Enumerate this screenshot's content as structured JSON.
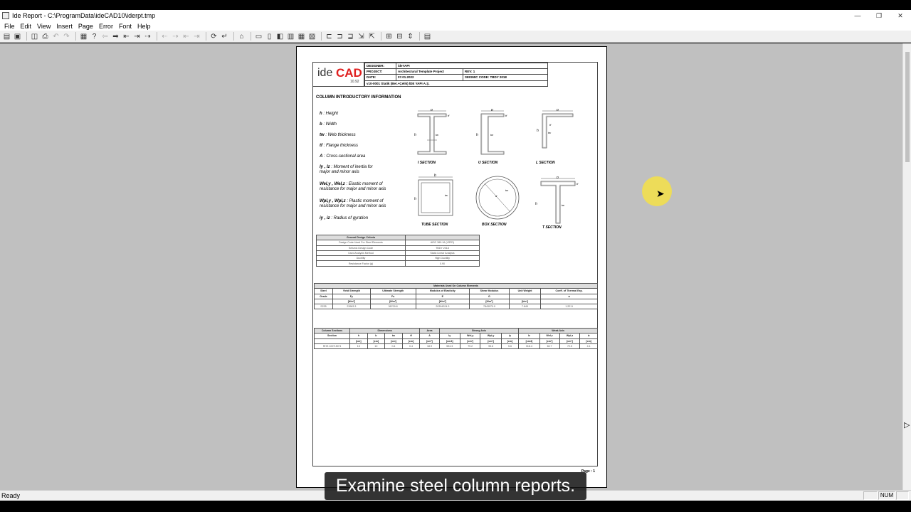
{
  "window": {
    "title": "Ide Report - C:\\ProgramData\\ideCAD10\\iderpt.tmp",
    "minimize": "—",
    "maximize": "❐",
    "close": "✕"
  },
  "menu": [
    "File",
    "Edit",
    "View",
    "Insert",
    "Page",
    "Error",
    "Font",
    "Help"
  ],
  "status": {
    "text": "Ready",
    "num": "NUM"
  },
  "report": {
    "logo": {
      "ide": "ide",
      "cad": "CAD",
      "version": "10.92"
    },
    "header": {
      "designer_label": "DESIGNER:",
      "designer": "ideYAPI",
      "project_label": "PROJECT:",
      "project": "Architectural Template Project",
      "rev": "REV: 1",
      "date_label": "DATE:",
      "date": "07.01.2022",
      "seismic": "SEISMIC CODE: TBDY 2018",
      "footer": "v10-0001 Statik (Bet.+Çelik) İDE YAPI A.Ş."
    },
    "section_title": "COLUMN INTRODUCTORY INFORMATION",
    "legend": [
      {
        "sym": "h",
        "text": ": Height"
      },
      {
        "sym": "b",
        "text": ": Width"
      },
      {
        "sym": "tw",
        "text": ": Web thickness"
      },
      {
        "sym": "tf",
        "text": ": Flange thickness"
      },
      {
        "sym": "A",
        "text": ": Cross-sectional area"
      },
      {
        "sym": "Iy , Iz",
        "text": ": Moment of inertia for",
        "text2": "major and minor axis"
      },
      {
        "sym": "Wel,y , Wel,z",
        "text": ": Elastic moment of",
        "text2": "resistance for major and minor axis"
      },
      {
        "sym": "Wpl,y , Wpl,z",
        "text": ": Plastic moment of",
        "text2": "resistance for major and minor axis"
      },
      {
        "sym": "iy , iz",
        "text": ": Radius of gyration"
      }
    ],
    "sections": {
      "i": "I SECTION",
      "u": "U SECTION",
      "l": "L SECTION",
      "tube": "TUBE SECTION",
      "box": "BOX SECTION",
      "t": "T SECTION"
    },
    "criteria": {
      "title": "General Design Criteria",
      "rows": [
        [
          "Design Code Used For Steel Elements",
          "AISC 360-16 (LRFD)"
        ],
        [
          "Seismic Design Code",
          "TBDY 2018"
        ],
        [
          "Used Analysis Method",
          "Static Linear Analysis"
        ],
        [
          "Ductility",
          "High Ductility"
        ],
        [
          "Resistance Factor (ϕ)",
          "0.90"
        ]
      ]
    },
    "materials": {
      "title": "Materials Used On Column Elements",
      "headers": [
        [
          "Steel",
          "Grade",
          ""
        ],
        [
          "Yield Strength",
          "Fy",
          "[tf/m²]"
        ],
        [
          "Ultimate Strength",
          "Fu",
          "[tf/m²]"
        ],
        [
          "Modulus of Elasticity",
          "E",
          "[tf/m²]"
        ],
        [
          "Shear Modulus",
          "G",
          "[tf/m²]"
        ],
        [
          "Unit Weight",
          "",
          "[t/m³]"
        ],
        [
          "Coeff. of Thermal Exp.",
          "α",
          ""
        ]
      ],
      "row": [
        "S235",
        "23963.3",
        "36709.8",
        "20394324.3",
        "7843970.9",
        "7.849",
        "1.2E-5"
      ]
    },
    "column_sections": {
      "groups": [
        "Column Sections",
        "Dimensions",
        "Area",
        "Strong Axis",
        "Weak Axis"
      ],
      "headers": [
        "Section",
        "h",
        "b",
        "tw",
        "tf",
        "A",
        "Iy",
        "Wel,y",
        "Wpl,y",
        "iy",
        "Iz",
        "Wel,z",
        "Wpl,z",
        "iz"
      ],
      "units": [
        "",
        "[cm]",
        "[cm]",
        "[cm]",
        "[cm]",
        "[cm²]",
        "[cm4]",
        "[cm³]",
        "[cm³]",
        "[cm]",
        "[cm4]",
        "[cm³]",
        "[cm³]",
        "[cm]"
      ],
      "row": [
        "RHS 100*150*4",
        "15",
        "10",
        "0.4",
        "0.4",
        "18.9",
        "594.3",
        "79.2",
        "95.6",
        "5.6",
        "318.4",
        "63.7",
        "72.5",
        "4.1"
      ]
    },
    "page_label": "Page : 1"
  },
  "caption": "Examine steel column reports."
}
